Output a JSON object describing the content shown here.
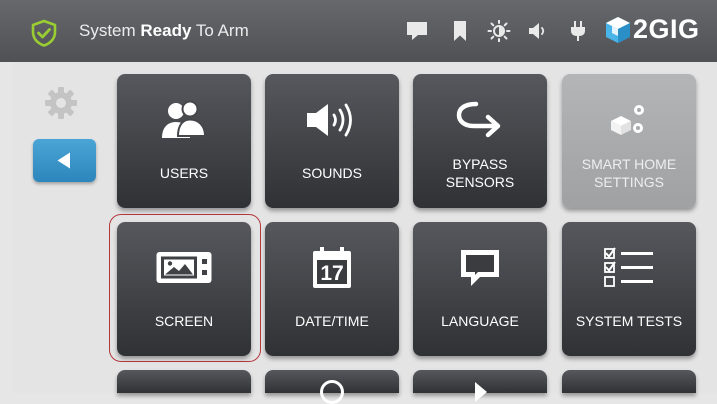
{
  "status": {
    "text_prefix": "System ",
    "text_bold": "Ready",
    "text_suffix": " To Arm",
    "shield_icon": "shield-check-icon",
    "shield_color": "#9acd32"
  },
  "topbar_icons": [
    "message-icon",
    "bookmark-icon",
    "brightness-icon",
    "volume-icon",
    "power-plug-icon"
  ],
  "brand": {
    "name": "2GIG",
    "logo_icon": "2gig-cube-logo"
  },
  "sidebar": {
    "gear_icon": "gear-icon",
    "back_icon": "back-arrow-icon",
    "back_color": "#3a96c8"
  },
  "tiles": [
    {
      "label": "USERS",
      "icon": "users-icon"
    },
    {
      "label": "SOUNDS",
      "icon": "speaker-icon"
    },
    {
      "label": "BYPASS SENSORS",
      "icon": "bypass-arrow-icon"
    },
    {
      "label": "SMART HOME SETTINGS",
      "icon": "smart-home-icon",
      "disabled": true
    },
    {
      "label": "SCREEN",
      "icon": "screen-icon",
      "selected": true
    },
    {
      "label": "DATE/TIME",
      "icon": "calendar-icon",
      "day": "17"
    },
    {
      "label": "LANGUAGE",
      "icon": "speech-bubble-icon"
    },
    {
      "label": "SYSTEM TESTS",
      "icon": "checklist-icon"
    }
  ],
  "colors": {
    "selection": "#b2383c",
    "tile_dark": "#3a3c40",
    "tile_disabled": "#a8a9ab",
    "header": "#5a5c60"
  }
}
